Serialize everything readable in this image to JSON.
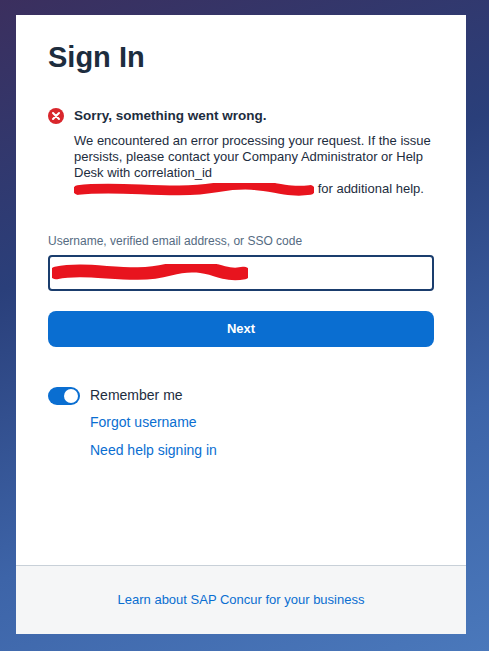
{
  "page": {
    "title": "Sign In"
  },
  "error": {
    "title": "Sorry, something went wrong.",
    "message": "We encountered an error processing your request. If the issue persists, please contact your Company Administrator or Help Desk with correlation_id",
    "message_end": "for additional help."
  },
  "username": {
    "label": "Username, verified email address, or SSO code",
    "focused": true
  },
  "buttons": [
    "Next"
  ],
  "remember_me": {
    "label": "Remember me",
    "on": true
  },
  "links": [
    "Forgot username",
    "Need help signing in"
  ],
  "footer": {
    "link": "Learn about SAP Concur for your business"
  }
}
